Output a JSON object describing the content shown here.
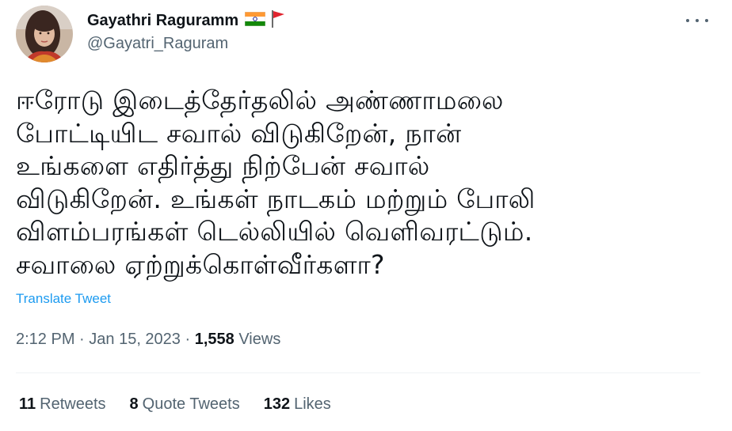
{
  "author": {
    "display_name": "Gayathri Raguramm",
    "handle": "@Gayatri_Raguram",
    "avatar_icon": "profile-photo",
    "badges": [
      "india-flag-icon",
      "red-flag-icon"
    ]
  },
  "tweet": {
    "text": "ஈரோடு இடைத்தேர்தலில் அண்ணாமலை\nபோட்டியிட சவால் விடுகிறேன், நான்\nஉங்களை எதிர்த்து நிற்பேன் சவால்\nவிடுகிறேன். உங்கள் நாடகம் மற்றும் போலி\nவிளம்பரங்கள் டெல்லியில் வெளிவரட்டும்.\nசவாலை ஏற்றுக்கொள்வீர்களா?",
    "translate_label": "Translate Tweet",
    "time": "2:12 PM",
    "separator": " · ",
    "date": "Jan 15, 2023",
    "views_count": "1,558",
    "views_label": "Views"
  },
  "stats": {
    "retweets_count": "11",
    "retweets_label": "Retweets",
    "quotes_count": "8",
    "quotes_label": "Quote Tweets",
    "likes_count": "132",
    "likes_label": "Likes"
  },
  "colors": {
    "link": "#1d9bf0",
    "secondary_text": "#536471",
    "primary_text": "#0f1419",
    "divider": "#eff3f4"
  }
}
